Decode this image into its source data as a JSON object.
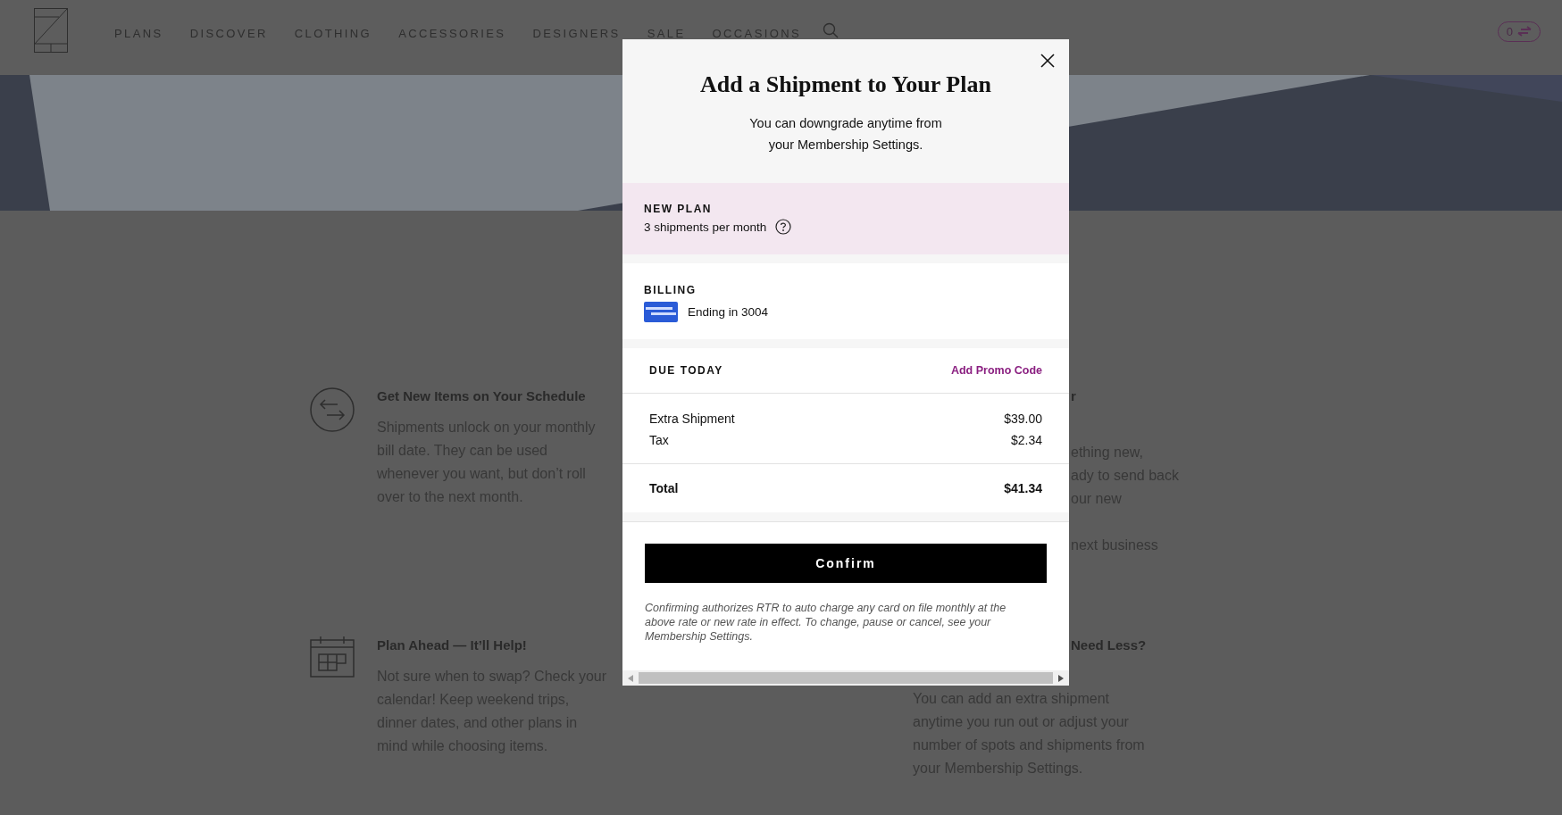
{
  "nav": {
    "items": [
      "PLANS",
      "DISCOVER",
      "CLOTHING",
      "ACCESSORIES",
      "DESIGNERS",
      "SALE",
      "OCCASIONS"
    ],
    "swap_count": "0"
  },
  "features_left": [
    {
      "kind": "swap",
      "title": "Get New Items on Your Schedule",
      "text": "Shipments unlock on your monthly bill date. They can be used whenever you want, but don’t roll over to the next month."
    },
    {
      "kind": "calendar",
      "title": "Plan Ahead — It’ll Help!",
      "text": "Not sure when to swap? Check your calendar! Keep weekend trips, dinner dates, and other plans in mind while choosing items."
    }
  ],
  "features_right": [
    {
      "fragments": [
        {
          "kind": "heading",
          "lines": [
            "r"
          ]
        },
        {
          "kind": "body",
          "lines": [
            "ething new,",
            "ady to send back",
            "our new"
          ]
        },
        {
          "kind": "body",
          "lines": [
            "next business"
          ]
        }
      ]
    },
    {
      "fragments": [
        {
          "kind": "heading",
          "lines": [
            "Need Less?"
          ]
        }
      ],
      "text": "You can add an extra shipment anytime you run out or adjust your number of spots and shipments from your Membership Settings."
    }
  ],
  "modal": {
    "title": "Add a Shipment to Your Plan",
    "subtitle": "You can downgrade anytime from your Membership Settings.",
    "new_plan": {
      "label": "NEW PLAN",
      "value": "3 shipments per month"
    },
    "billing": {
      "label": "BILLING",
      "card": "Ending in 3004"
    },
    "due_today": {
      "label": "DUE TODAY",
      "promo_link": "Add Promo Code"
    },
    "line_items": [
      {
        "label": "Extra Shipment",
        "amount": "$39.00"
      },
      {
        "label": "Tax",
        "amount": "$2.34"
      }
    ],
    "total": {
      "label": "Total",
      "amount": "$41.34"
    },
    "confirm": "Confirm",
    "disclaimer": "Confirming authorizes RTR to auto charge any card on file monthly at the above rate or new rate in effect. To change, pause or cancel, see your Membership Settings."
  }
}
